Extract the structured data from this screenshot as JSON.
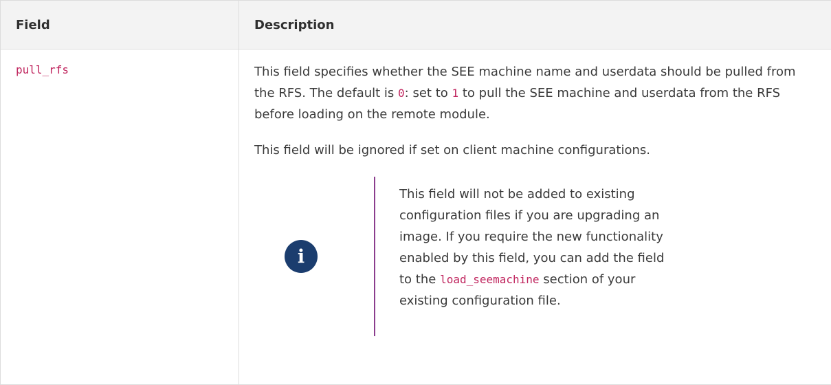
{
  "table": {
    "headers": [
      "Field",
      "Description"
    ],
    "row": {
      "field": "pull_rfs",
      "description": {
        "para1_part1": "This field specifies whether the SEE machine name and userdata should be pulled from the RFS. The default is ",
        "value_default": "0",
        "para1_part2": ": set to ",
        "value_pull": "1",
        "para1_part3": " to pull the SEE machine and userdata from the RFS before loading on the remote module.",
        "para2": "This field will be ignored if set on client machine configurations.",
        "note": {
          "icon": "info-icon",
          "icon_glyph": "i",
          "text_part1": "This field will not be added to existing configuration files if you are upgrading an image. If you require the new functionality enabled by this field, you can add the field to the ",
          "code": "load_seemachine",
          "text_part2": " section of your existing configuration file."
        }
      }
    }
  },
  "colors": {
    "header_bg": "#f3f3f3",
    "code_color": "#c0255e",
    "icon_bg": "#1b3d6e",
    "note_border": "#8b3d8d"
  }
}
